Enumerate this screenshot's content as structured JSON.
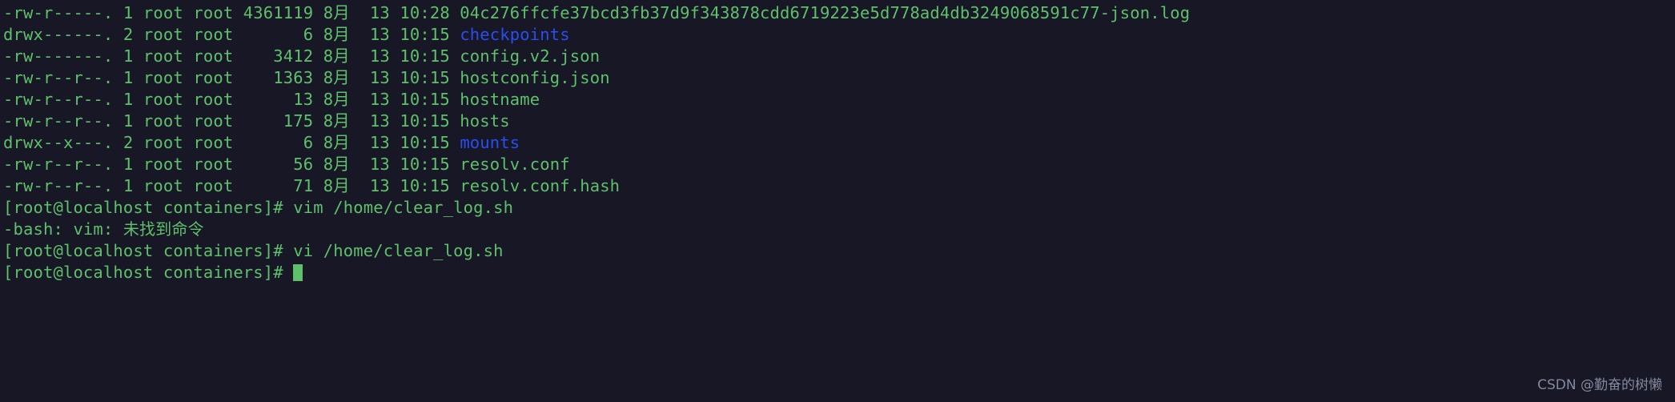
{
  "terminal": {
    "background_color": "#171726",
    "text_color": "#5fc06b",
    "directory_color": "#2a4ef0",
    "watermark": "CSDN @勤奋的树懒",
    "cursor": {
      "shape": "block",
      "color": "#5fc06b"
    },
    "lines": [
      {
        "id": "listing-json-log",
        "type": "listing",
        "perms": "-rw-r-----.",
        "links": "1",
        "owner": "root",
        "group": "root",
        "size": "4361119",
        "month": "8月",
        "day": "13",
        "time": "10:28",
        "name": "04c276ffcfe37bcd3fb37d9f343878cdd6719223e5d778ad4db3249068591c77-json.log",
        "name_color": "green",
        "text": "-rw-r-----. 1 root root 4361119 8月  13 10:28 04c276ffcfe37bcd3fb37d9f343878cdd6719223e5d778ad4db3249068591c77-json.log"
      },
      {
        "id": "listing-checkpoints",
        "type": "listing",
        "perms": "drwx------.",
        "links": "2",
        "owner": "root",
        "group": "root",
        "size": "6",
        "month": "8月",
        "day": "13",
        "time": "10:15",
        "name": "checkpoints",
        "name_color": "blue",
        "prefix": "drwx------. 2 root root       6 8月  13 10:15 "
      },
      {
        "id": "listing-config-v2-json",
        "type": "listing",
        "perms": "-rw-------.",
        "links": "1",
        "owner": "root",
        "group": "root",
        "size": "3412",
        "month": "8月",
        "day": "13",
        "time": "10:15",
        "name": "config.v2.json",
        "name_color": "green",
        "text": "-rw-------. 1 root root    3412 8月  13 10:15 config.v2.json"
      },
      {
        "id": "listing-hostconfig-json",
        "type": "listing",
        "perms": "-rw-r--r--.",
        "links": "1",
        "owner": "root",
        "group": "root",
        "size": "1363",
        "month": "8月",
        "day": "13",
        "time": "10:15",
        "name": "hostconfig.json",
        "name_color": "green",
        "text": "-rw-r--r--. 1 root root    1363 8月  13 10:15 hostconfig.json"
      },
      {
        "id": "listing-hostname",
        "type": "listing",
        "perms": "-rw-r--r--.",
        "links": "1",
        "owner": "root",
        "group": "root",
        "size": "13",
        "month": "8月",
        "day": "13",
        "time": "10:15",
        "name": "hostname",
        "name_color": "green",
        "text": "-rw-r--r--. 1 root root      13 8月  13 10:15 hostname"
      },
      {
        "id": "listing-hosts",
        "type": "listing",
        "perms": "-rw-r--r--.",
        "links": "1",
        "owner": "root",
        "group": "root",
        "size": "175",
        "month": "8月",
        "day": "13",
        "time": "10:15",
        "name": "hosts",
        "name_color": "green",
        "text": "-rw-r--r--. 1 root root     175 8月  13 10:15 hosts"
      },
      {
        "id": "listing-mounts",
        "type": "listing",
        "perms": "drwx--x---.",
        "links": "2",
        "owner": "root",
        "group": "root",
        "size": "6",
        "month": "8月",
        "day": "13",
        "time": "10:15",
        "name": "mounts",
        "name_color": "blue",
        "prefix": "drwx--x---. 2 root root       6 8月  13 10:15 "
      },
      {
        "id": "listing-resolv-conf",
        "type": "listing",
        "perms": "-rw-r--r--.",
        "links": "1",
        "owner": "root",
        "group": "root",
        "size": "56",
        "month": "8月",
        "day": "13",
        "time": "10:15",
        "name": "resolv.conf",
        "name_color": "green",
        "text": "-rw-r--r--. 1 root root      56 8月  13 10:15 resolv.conf"
      },
      {
        "id": "listing-resolv-conf-hash",
        "type": "listing",
        "perms": "-rw-r--r--.",
        "links": "1",
        "owner": "root",
        "group": "root",
        "size": "71",
        "month": "8月",
        "day": "13",
        "time": "10:15",
        "name": "resolv.conf.hash",
        "name_color": "green",
        "text": "-rw-r--r--. 1 root root      71 8月  13 10:15 resolv.conf.hash"
      },
      {
        "id": "prompt-vim",
        "type": "command",
        "prompt": "[root@localhost containers]# ",
        "command": "vim /home/clear_log.sh",
        "text": "[root@localhost containers]# vim /home/clear_log.sh"
      },
      {
        "id": "error-vim-not-found",
        "type": "error",
        "text_ascii": "-bash: vim: ",
        "text_cjk": "未找到命令"
      },
      {
        "id": "prompt-vi",
        "type": "command",
        "prompt": "[root@localhost containers]# ",
        "command": "vi /home/clear_log.sh",
        "text": "[root@localhost containers]# vi /home/clear_log.sh"
      },
      {
        "id": "prompt-active",
        "type": "prompt",
        "prompt": "[root@localhost containers]# ",
        "text": "[root@localhost containers]# "
      }
    ]
  }
}
